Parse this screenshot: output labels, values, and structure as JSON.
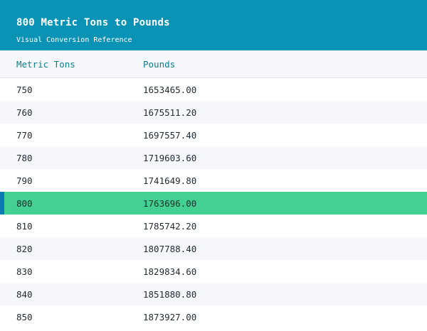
{
  "header": {
    "title": "800 Metric Tons to Pounds",
    "subtitle": "Visual Conversion Reference"
  },
  "table": {
    "columns": [
      "Metric Tons",
      "Pounds"
    ],
    "highlighted_index": 5,
    "rows": [
      [
        "750",
        "1653465.00"
      ],
      [
        "760",
        "1675511.20"
      ],
      [
        "770",
        "1697557.40"
      ],
      [
        "780",
        "1719603.60"
      ],
      [
        "790",
        "1741649.80"
      ],
      [
        "800",
        "1763696.00"
      ],
      [
        "810",
        "1785742.20"
      ],
      [
        "820",
        "1807788.40"
      ],
      [
        "830",
        "1829834.60"
      ],
      [
        "840",
        "1851880.80"
      ],
      [
        "850",
        "1873927.00"
      ]
    ]
  },
  "colors": {
    "header_bg": "#0a93b4",
    "highlight_row": "#45d093",
    "highlight_marker": "#0b7ab5",
    "column_header_text": "#0b7f8c"
  }
}
